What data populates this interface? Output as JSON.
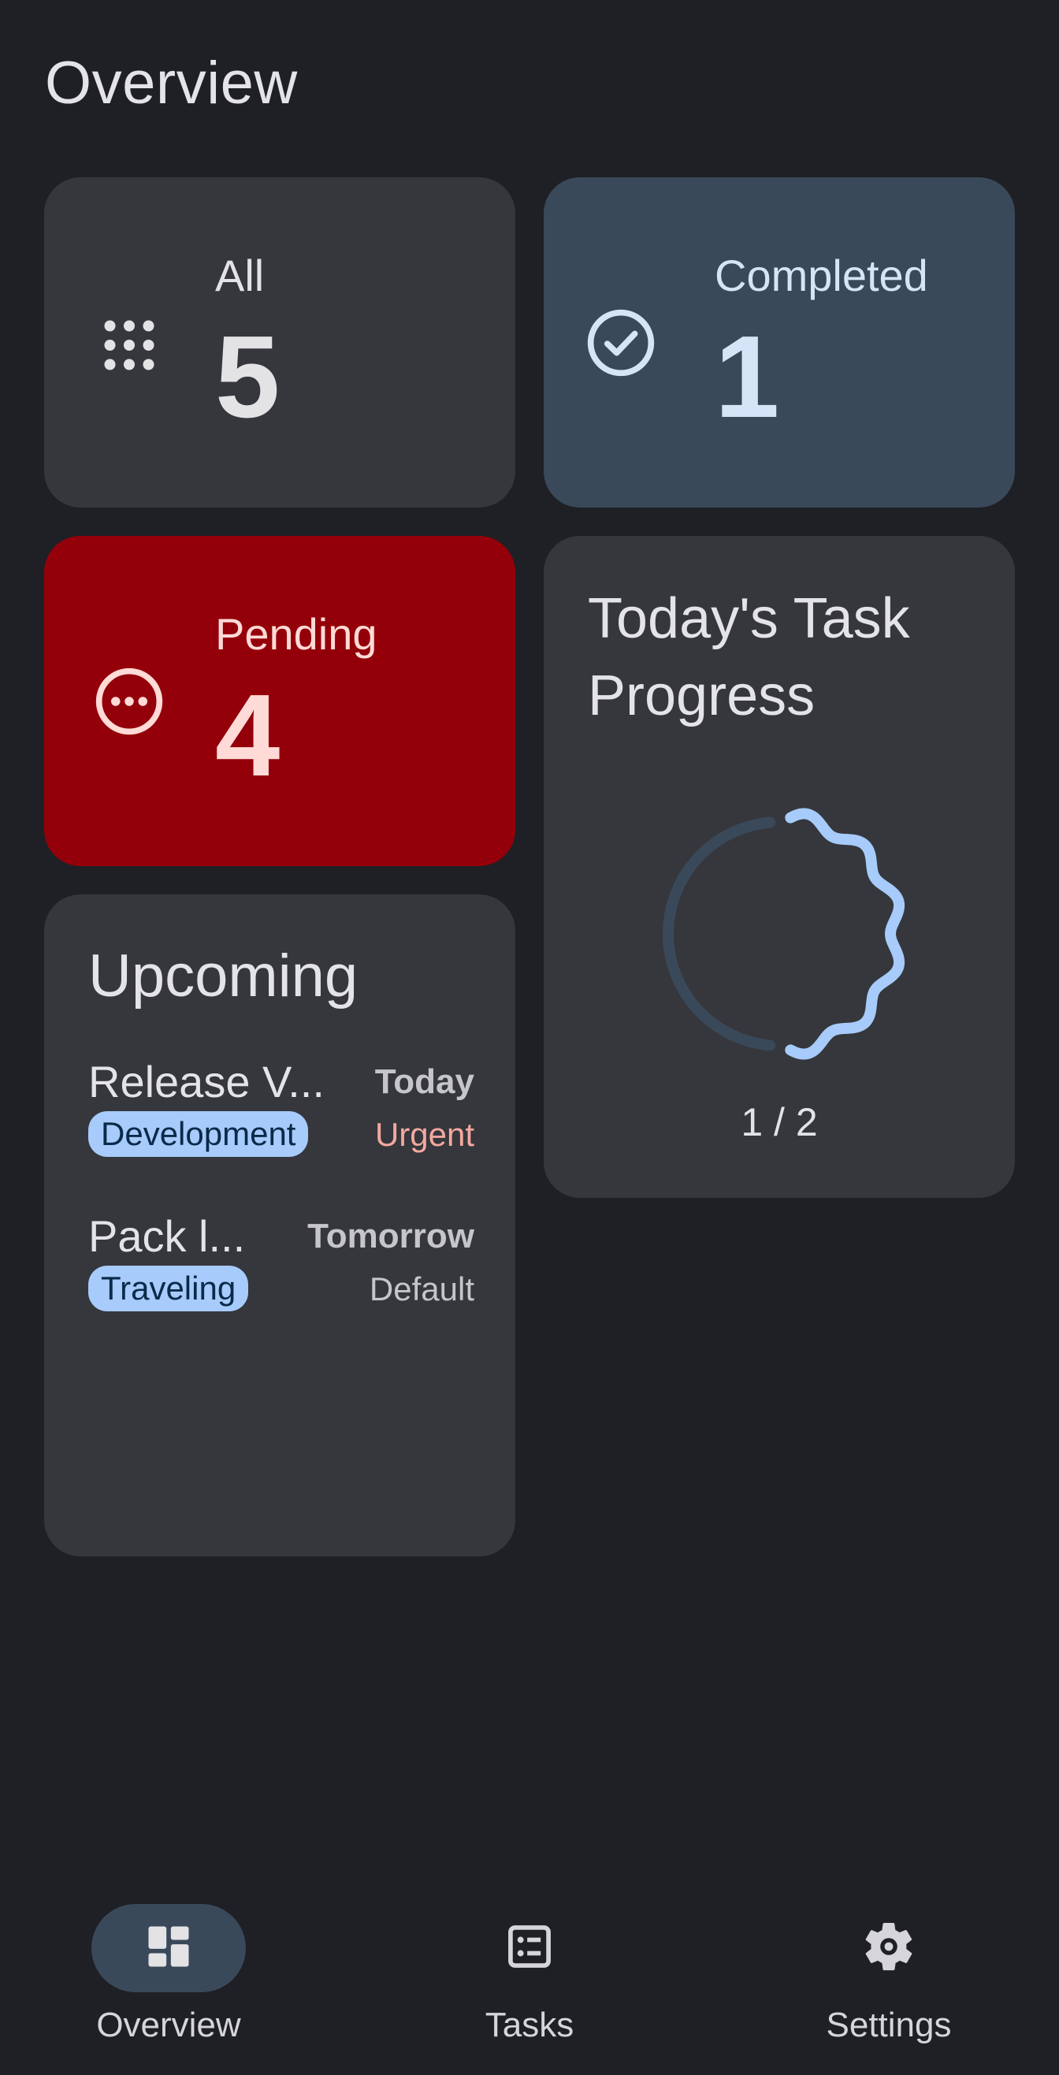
{
  "page": {
    "title": "Overview"
  },
  "stats": {
    "all": {
      "label": "All",
      "count": "5",
      "icon": "apps-grid-icon",
      "bg": "#35373c",
      "fg": "#e3e3e6"
    },
    "completed": {
      "label": "Completed",
      "count": "1",
      "icon": "check-circle-icon",
      "bg": "#3a495a",
      "fg": "#d6e4f7"
    },
    "pending": {
      "label": "Pending",
      "count": "4",
      "icon": "more-horizontal-circle-icon",
      "bg": "#93000a",
      "fg": "#ffdad6"
    }
  },
  "progress": {
    "title": "Today's Task Progress",
    "completed": 1,
    "total": 2,
    "text": "1 / 2",
    "accent": "#a7cbfa",
    "track": "#3a495a"
  },
  "upcoming": {
    "title": "Upcoming",
    "tasks": [
      {
        "name": "Release V...",
        "date": "Today",
        "tag": "Development",
        "priority": "Urgent",
        "priority_color": "#f4a89f"
      },
      {
        "name": "Pack l...",
        "date": "Tomorrow",
        "tag": "Traveling",
        "priority": "Default",
        "priority_color": "#c6c6ca"
      }
    ]
  },
  "nav": {
    "items": [
      {
        "label": "Overview",
        "icon": "dashboard-icon",
        "active": true
      },
      {
        "label": "Tasks",
        "icon": "task-list-icon",
        "active": false
      },
      {
        "label": "Settings",
        "icon": "gear-icon",
        "active": false
      }
    ]
  }
}
